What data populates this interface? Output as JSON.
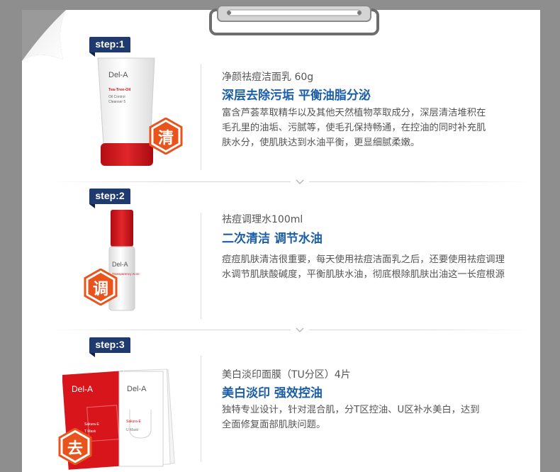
{
  "steps": [
    {
      "step_label": "step:1",
      "product_name": "净颜祛痘洁面乳 60g",
      "headline": "深层去除污垢  平衡油脂分泌",
      "description": [
        "富含芦荟萃取精华以及其他天然植物萃取成分，深层清洁堆积在",
        "毛孔里的油垢、污腻等，使毛孔保持畅通，在控油的同时补充肌",
        "肤水分，使肌肤达到水油平衡，更显细腻柔嫩。"
      ],
      "badge_char": "清",
      "package": {
        "brand": "Del-A",
        "line1": "Tea-Tree-Oil",
        "line2": "Oil Control",
        "line3": "Cleanser 5"
      }
    },
    {
      "step_label": "step:2",
      "product_name": "祛痘调理水100ml",
      "headline": "二次清洁  调节水油",
      "description": [
        "痘痘肌肤清洁很重要，每天使用祛痘洁面乳之后，还要使用祛痘调理",
        "水调节肌肤酸碱度，平衡肌肤水油，彻底根除肌肤出油这一长痘根源"
      ],
      "badge_char": "调",
      "package": {
        "brand": "Del-A",
        "line1": "Transparency Acne"
      }
    },
    {
      "step_label": "step:3",
      "product_name": "美白淡印面膜（TU分区）4片",
      "headline": "美白淡印  强效控油",
      "description": [
        "独特专业设计，针对混合肌，分T区控油、U区补水美白，达到",
        "全面修复面部肌肤问题。"
      ],
      "badge_char": "去",
      "package": {
        "brand_left": "Del-A",
        "brand_right": "Del-A",
        "left_sub": "Sakura-E",
        "left_mask": "T Mask",
        "right_sub": "Sakura-E",
        "right_mask": "U Mask"
      }
    }
  ],
  "colors": {
    "step_tab": "#1f3a6f",
    "headline": "#1b5ea6",
    "hex_badge": "#e8541c",
    "product_red": "#d7151b",
    "frame": "#8e8e8e"
  }
}
